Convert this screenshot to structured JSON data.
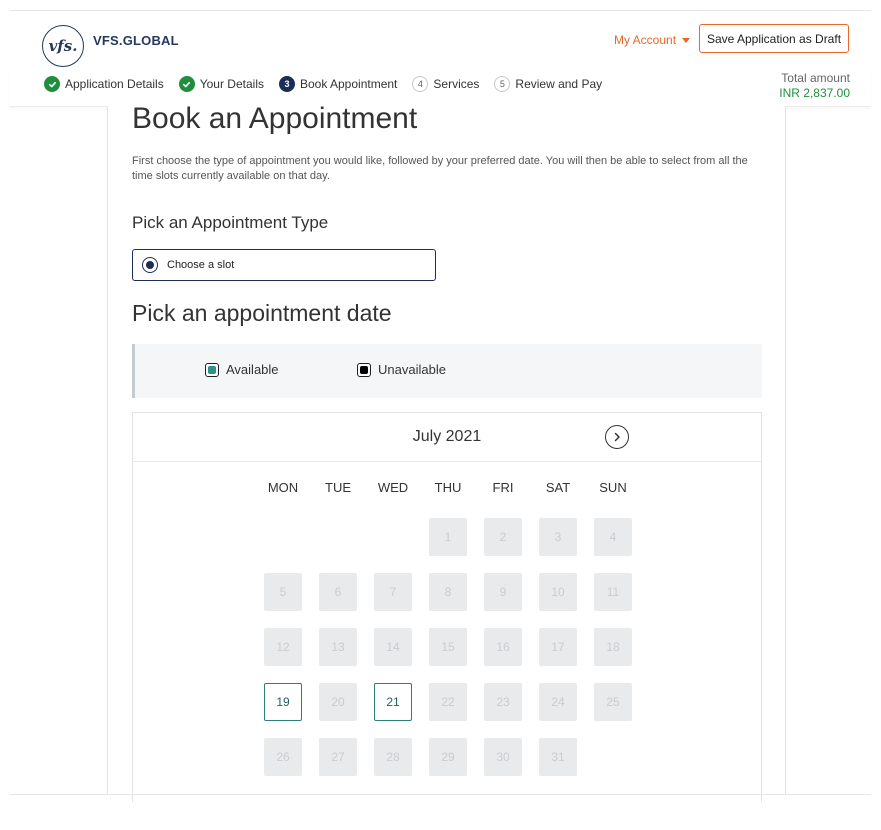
{
  "header": {
    "logo_mark": "vfs.",
    "logo_text": "VFS.GLOBAL",
    "my_account_label": "My Account",
    "save_draft_label": "Save Application as Draft"
  },
  "stepper": {
    "steps": [
      {
        "number": "1",
        "label": "Application Details",
        "status": "done"
      },
      {
        "number": "2",
        "label": "Your Details",
        "status": "done"
      },
      {
        "number": "3",
        "label": "Book Appointment",
        "status": "current"
      },
      {
        "number": "4",
        "label": "Services",
        "status": "todo"
      },
      {
        "number": "5",
        "label": "Review and Pay",
        "status": "todo"
      }
    ],
    "total_label": "Total amount",
    "total_value": "INR 2,837.00"
  },
  "main": {
    "title": "Book an Appointment",
    "intro": "First choose the type of appointment you would like, followed by your preferred date. You will then be able to select from all the time slots currently available on that day.",
    "type_heading": "Pick an Appointment Type",
    "slot_option_label": "Choose a slot",
    "date_heading": "Pick an appointment date",
    "legend": {
      "available": "Available",
      "unavailable": "Unavailable"
    }
  },
  "calendar": {
    "month": "July 2021",
    "weekdays": [
      "MON",
      "TUE",
      "WED",
      "THU",
      "FRI",
      "SAT",
      "SUN"
    ],
    "first_weekday_index": 3,
    "days_in_month": 31,
    "available_days": [
      19,
      21
    ]
  },
  "colors": {
    "accent_orange": "#e8672a",
    "brand_navy": "#1c2e57",
    "success_green": "#1f8f3d",
    "available_teal": "#2d9186"
  }
}
